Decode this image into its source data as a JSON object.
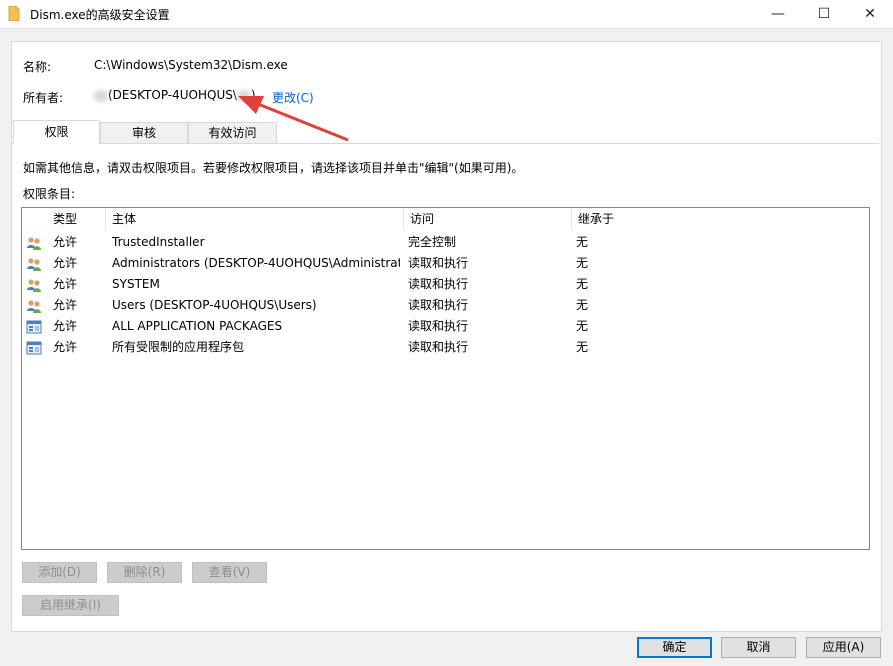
{
  "window": {
    "title": "Dism.exe的高级安全设置",
    "minimize_glyph": "—",
    "maximize_glyph": "☐",
    "close_glyph": "✕"
  },
  "info": {
    "name_label": "名称:",
    "name_value": "C:\\Windows\\System32\\Dism.exe",
    "owner_label": "所有者:",
    "owner_value": "(DESKTOP-4UOHQUS\\",
    "owner_suffix": ")",
    "change_link": "更改(C)"
  },
  "tabs": [
    "权限",
    "审核",
    "有效访问"
  ],
  "instructions": "如需其他信息，请双击权限项目。若要修改权限项目，请选择该项目并单击\"编辑\"(如果可用)。",
  "entries_label": "权限条目:",
  "table": {
    "headers": [
      "类型",
      "主体",
      "访问",
      "继承于"
    ],
    "rows": [
      {
        "icon": "users-icon",
        "type": "允许",
        "principal": "TrustedInstaller",
        "access": "完全控制",
        "inherited": "无"
      },
      {
        "icon": "users-icon",
        "type": "允许",
        "principal": "Administrators (DESKTOP-4UOHQUS\\Administrat...",
        "access": "读取和执行",
        "inherited": "无"
      },
      {
        "icon": "users-icon",
        "type": "允许",
        "principal": "SYSTEM",
        "access": "读取和执行",
        "inherited": "无"
      },
      {
        "icon": "users-icon",
        "type": "允许",
        "principal": "Users (DESKTOP-4UOHQUS\\Users)",
        "access": "读取和执行",
        "inherited": "无"
      },
      {
        "icon": "app-package-icon",
        "type": "允许",
        "principal": "ALL APPLICATION PACKAGES",
        "access": "读取和执行",
        "inherited": "无"
      },
      {
        "icon": "app-package-icon",
        "type": "允许",
        "principal": "所有受限制的应用程序包",
        "access": "读取和执行",
        "inherited": "无"
      }
    ]
  },
  "buttons": {
    "add": "添加(D)",
    "remove": "删除(R)",
    "view": "查看(V)",
    "enable_inheritance": "启用继承(I)",
    "ok": "确定",
    "cancel": "取消",
    "apply": "应用(A)"
  },
  "colors": {
    "link": "#0066cc",
    "accent": "#0078d7",
    "annotation_arrow": "#e0403a"
  }
}
